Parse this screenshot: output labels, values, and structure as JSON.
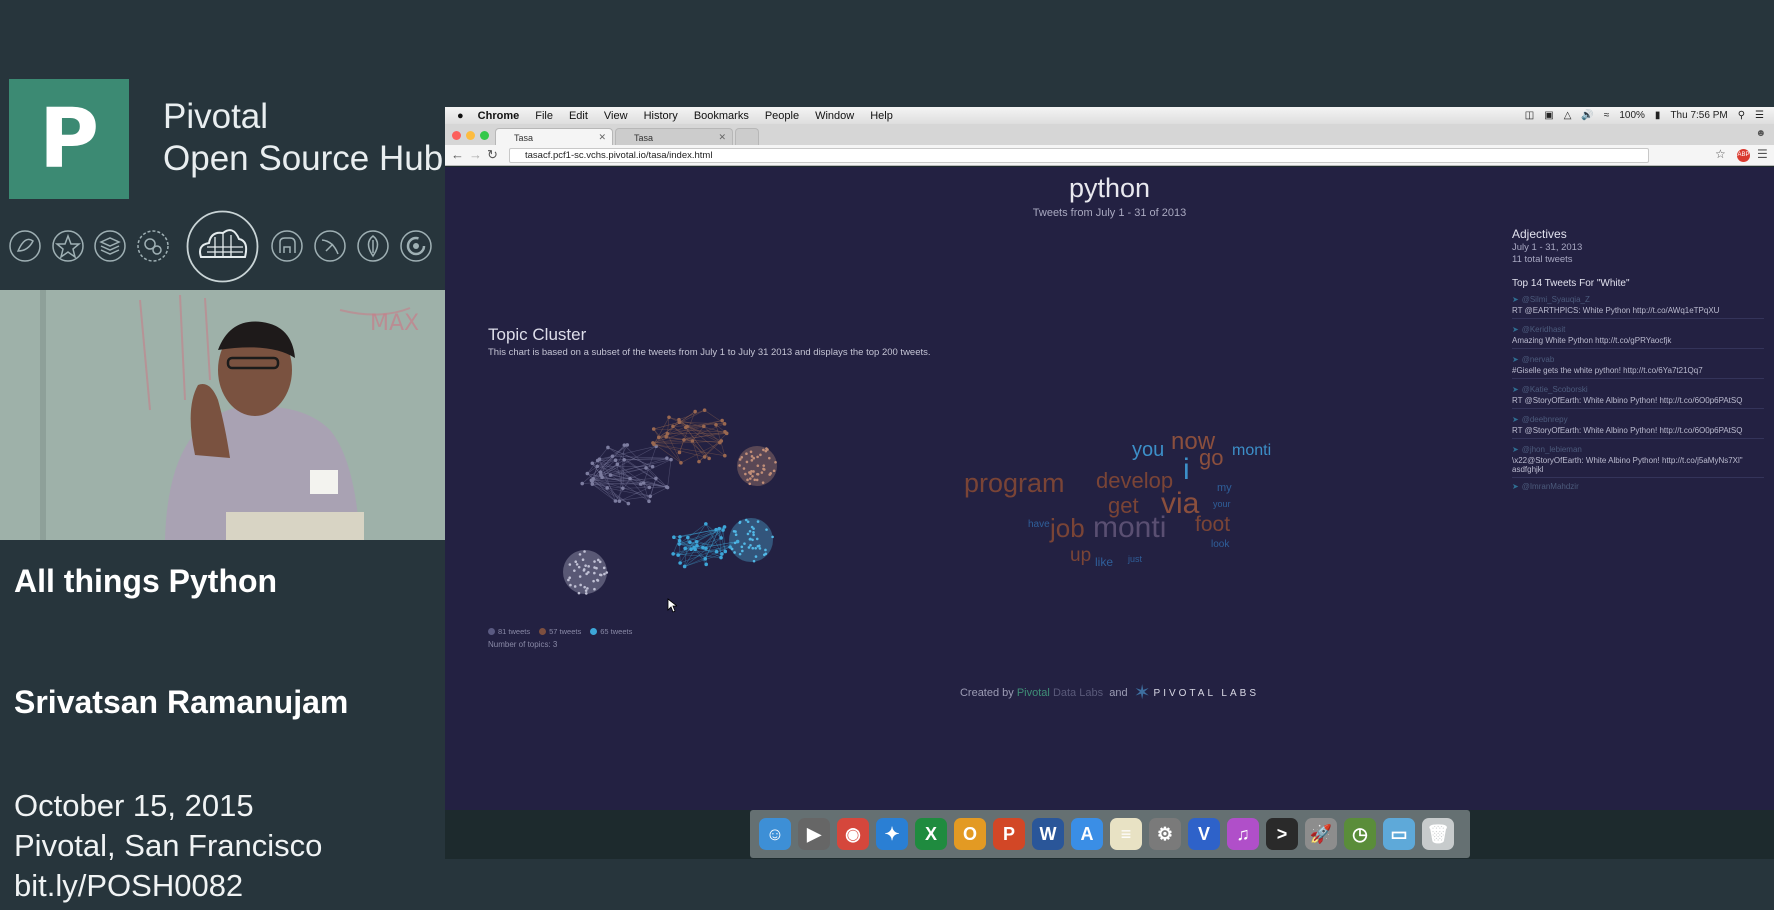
{
  "slide": {
    "logo_letter": "P",
    "brand_line1": "Pivotal",
    "brand_line2": "Open Source Hub",
    "product_icons": [
      "leaf-icon",
      "star-icon",
      "layers-icon",
      "gears-icon",
      "cloud-grid-icon",
      "elephant-icon",
      "analytics-icon",
      "leaf-shield-icon",
      "loop-icon"
    ],
    "talk_title": "All things Python",
    "speaker": "Srivatsan Ramanujam",
    "date": "October 15, 2015",
    "location": "Pivotal, San Francisco",
    "link": "bit.ly/POSH0082"
  },
  "menubar": {
    "app": "Chrome",
    "items": [
      "File",
      "Edit",
      "View",
      "History",
      "Bookmarks",
      "People",
      "Window",
      "Help"
    ],
    "battery": "100%",
    "clock": "Thu 7:56 PM"
  },
  "browser": {
    "tabs": [
      {
        "label": "Tasa"
      },
      {
        "label": "Tasa"
      }
    ],
    "url": "tasacf.pcf1-sc.vchs.pivotal.io/tasa/index.html"
  },
  "page": {
    "title": "python",
    "subtitle": "Tweets from July 1 - 31 of 2013",
    "topic_cluster": {
      "title": "Topic Cluster",
      "description": "This chart is based on a subset of the tweets from July 1 to July 31 2013 and displays the top 200 tweets.",
      "legend": [
        {
          "label": "81 tweets",
          "color": "#8e8eb0"
        },
        {
          "label": "57 tweets",
          "color": "#b77558"
        },
        {
          "label": "65 tweets",
          "color": "#3da6d8"
        }
      ],
      "num_topics": "Number of topics:  3"
    },
    "word_cloud": [
      {
        "text": "you",
        "color": "#3c8fc8"
      },
      {
        "text": "now",
        "color": "#8b4f3d"
      },
      {
        "text": "monti",
        "color": "#3c8fc8"
      },
      {
        "text": "i",
        "color": "#3c8fc8"
      },
      {
        "text": "go",
        "color": "#8b4f3d"
      },
      {
        "text": "program",
        "color": "#7a4436"
      },
      {
        "text": "develop",
        "color": "#7a4436"
      },
      {
        "text": "get",
        "color": "#7a4436"
      },
      {
        "text": "via",
        "color": "#8b4f3d"
      },
      {
        "text": "my",
        "color": "#2f5f9a"
      },
      {
        "text": "your",
        "color": "#2f5f9a"
      },
      {
        "text": "have",
        "color": "#2f5f9a"
      },
      {
        "text": "job",
        "color": "#7a4436"
      },
      {
        "text": "monti",
        "color": "#5a4f72"
      },
      {
        "text": "foot",
        "color": "#7a4436"
      },
      {
        "text": "look",
        "color": "#2f5f9a"
      },
      {
        "text": "up",
        "color": "#7a4436"
      },
      {
        "text": "like",
        "color": "#2f5f9a"
      },
      {
        "text": "just",
        "color": "#2f5f9a"
      }
    ],
    "adjectives": {
      "title": "Adjectives",
      "range": "July 1 - 31, 2013",
      "count": "11 total tweets",
      "top_title": "Top 14 Tweets For \"White\"",
      "tweets": [
        {
          "user": "@Silmi_Syauqia_Z",
          "text": "RT @EARTHPICS: White Python http://t.co/AWq1eTPqXU"
        },
        {
          "user": "@Keridhasit",
          "text": "Amazing White Python http://t.co/gPRYaocfjk"
        },
        {
          "user": "@nervab",
          "text": "#Giselle gets the white python! http://t.co/6Ya7t21Qq7"
        },
        {
          "user": "@Katie_Scoborski",
          "text": "RT @StoryOfEarth: White Albino Python! http://t.co/6O0p6PAtSQ"
        },
        {
          "user": "@deebnrepy",
          "text": "RT @StoryOfEarth: White Albino Python! http://t.co/6O0p6PAtSQ"
        },
        {
          "user": "@jhon_lebieman",
          "text": "\\x22@StoryOfEarth: White Albino Python! http://t.co/j5aMyNs7Xl\" asdfghjkl"
        },
        {
          "user": "@ImranMahdzir",
          "text": ""
        }
      ]
    },
    "footer": {
      "created_by": "Created by",
      "pivotal": "Pivotal",
      "data_labs": "Data Labs",
      "and": "and",
      "labs_logo": "PIVOTAL LABS"
    }
  },
  "dock": {
    "icons": [
      {
        "name": "finder-icon",
        "color": "#3d8fd6",
        "glyph": "☺"
      },
      {
        "name": "imovie-icon",
        "color": "#666666",
        "glyph": "▶"
      },
      {
        "name": "chrome-icon",
        "color": "#d5473c",
        "glyph": "◉"
      },
      {
        "name": "safari-icon",
        "color": "#2a7fd4",
        "glyph": "✦"
      },
      {
        "name": "excel-icon",
        "color": "#1f8b3f",
        "glyph": "X"
      },
      {
        "name": "outlook-icon",
        "color": "#e39a23",
        "glyph": "O"
      },
      {
        "name": "powerpoint-icon",
        "color": "#d24726",
        "glyph": "P"
      },
      {
        "name": "word-icon",
        "color": "#2a5699",
        "glyph": "W"
      },
      {
        "name": "app-store-icon",
        "color": "#3a8ee6",
        "glyph": "A"
      },
      {
        "name": "notes-icon",
        "color": "#e8e2c4",
        "glyph": "≡"
      },
      {
        "name": "system-preferences-icon",
        "color": "#7a7a7a",
        "glyph": "⚙"
      },
      {
        "name": "vim-icon",
        "color": "#2e62c9",
        "glyph": "V"
      },
      {
        "name": "itunes-icon",
        "color": "#b04fc9",
        "glyph": "♫"
      },
      {
        "name": "terminal-icon",
        "color": "#2a2a2a",
        "glyph": ">"
      },
      {
        "name": "launchpad-icon",
        "color": "#8d8d8d",
        "glyph": "🚀"
      },
      {
        "name": "time-machine-icon",
        "color": "#5a8d3a",
        "glyph": "◷"
      },
      {
        "name": "downloads-folder-icon",
        "color": "#5ea9d9",
        "glyph": "▭"
      },
      {
        "name": "trash-icon",
        "color": "#c7cbcc",
        "glyph": "🗑"
      }
    ]
  }
}
